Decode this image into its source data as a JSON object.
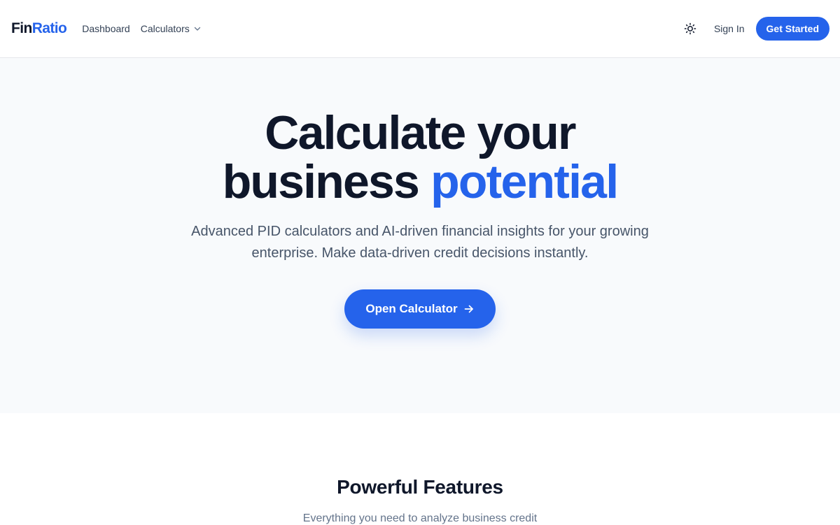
{
  "brand": {
    "name_part1": "Fin",
    "name_part2": "Ratio",
    "accent_color": "#2563eb"
  },
  "nav": {
    "dashboard": "Dashboard",
    "calculators": "Calculators",
    "calculators_icon": "chevron-down-icon"
  },
  "header_actions": {
    "theme_icon": "sun-icon",
    "sign_in": "Sign In",
    "get_started": "Get Started"
  },
  "hero": {
    "title_line1": "Calculate your",
    "title_line2_plain": "business ",
    "title_line2_accent": "potential",
    "subtitle_line1": "Advanced PID calculators and AI-driven financial insights for your growing",
    "subtitle_line2": "enterprise. Make data-driven credit decisions instantly.",
    "cta_label": "Open Calculator",
    "cta_icon": "arrow-right-icon"
  },
  "features": {
    "title": "Powerful Features",
    "subtitle": "Everything you need to analyze business credit"
  }
}
